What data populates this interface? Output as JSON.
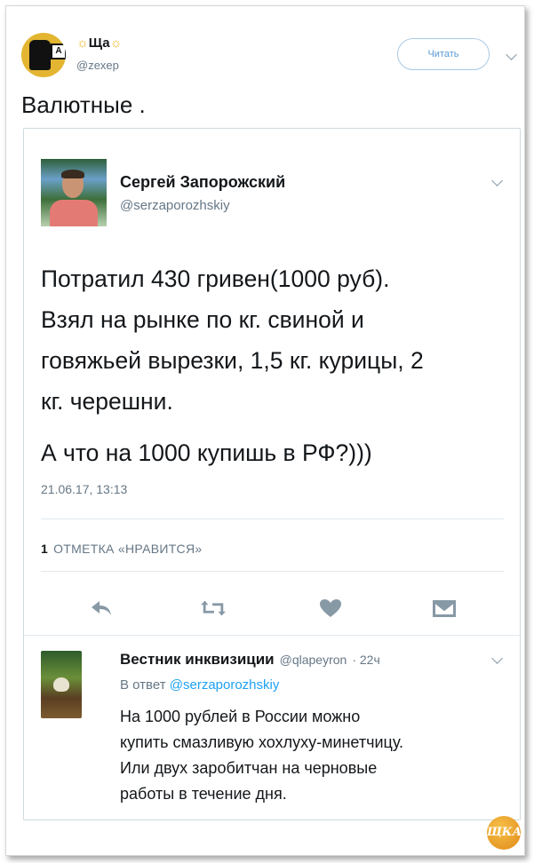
{
  "outer_tweet": {
    "name": "Ща",
    "handle": "@zexep",
    "follow_label": "Читать",
    "text": "Валютные ."
  },
  "quoted_tweet": {
    "name": "Сергей Запорожский",
    "handle": "@serzaporozhskiy",
    "lines": [
      "Потратил 430 гривен(1000 руб).",
      "Взял на рынке по кг. свиной и",
      "говяжьей вырезки, 1,5 кг. курицы, 2",
      "кг. черешни."
    ],
    "line2": "А что на 1000 купишь в РФ?)))",
    "timestamp": "21.06.17, 13:13",
    "likes_count": "1",
    "likes_label": "ОТМЕТКА «НРАВИТСЯ»",
    "actions": [
      "reply-icon",
      "retweet-icon",
      "heart-icon",
      "dm-icon"
    ]
  },
  "reply": {
    "name": "Вестник инквизиции",
    "handle": "@qlapeyron",
    "time": "· 22ч",
    "reply_prefix": "В ответ",
    "reply_to": "@serzaporozhskiy",
    "lines": [
      "На 1000 рублей в России можно",
      "купить смазливую хохлуху-минетчицу.",
      "Или двух заробитчан на черновые",
      "работы в течение дня."
    ]
  },
  "watermark": "ЩКА",
  "colors": {
    "text": "#14171a",
    "muted": "#657786",
    "link": "#1da1f2",
    "icon": "#8899a6"
  }
}
